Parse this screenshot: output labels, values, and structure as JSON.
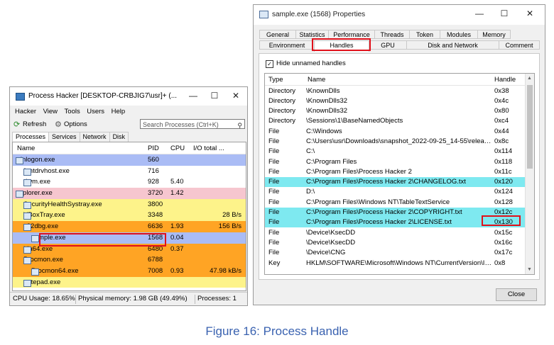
{
  "process_hacker": {
    "title": "Process Hacker [DESKTOP-CRBJIG7\\usr]+ (...",
    "menu": [
      "Hacker",
      "View",
      "Tools",
      "Users",
      "Help"
    ],
    "toolbar": {
      "refresh": "Refresh",
      "options": "Options",
      "search_placeholder": "Search Processes (Ctrl+K)"
    },
    "tabs": [
      "Processes",
      "Services",
      "Network",
      "Disk"
    ],
    "columns": {
      "name": "Name",
      "pid": "PID",
      "cpu": "CPU",
      "io": "I/O total ..."
    },
    "rows": [
      {
        "name": "winlogon.exe",
        "pid": "560",
        "cpu": "",
        "io": "",
        "color": "#aabcf5",
        "indent": 0,
        "expanded": true
      },
      {
        "name": "fontdrvhost.exe",
        "pid": "716",
        "cpu": "",
        "io": "",
        "color": "#ffffff",
        "indent": 1
      },
      {
        "name": "dwm.exe",
        "pid": "928",
        "cpu": "5.40",
        "io": "",
        "color": "#ffffff",
        "indent": 1
      },
      {
        "name": "explorer.exe",
        "pid": "3720",
        "cpu": "1.42",
        "io": "",
        "color": "#f6c6cf",
        "indent": 0,
        "expanded": true
      },
      {
        "name": "SecurityHealthSystray.exe",
        "pid": "3800",
        "cpu": "",
        "io": "",
        "color": "#fdf38a",
        "indent": 1
      },
      {
        "name": "VBoxTray.exe",
        "pid": "3348",
        "cpu": "",
        "io": "28 B/s",
        "color": "#fdf38a",
        "indent": 1
      },
      {
        "name": "x32dbg.exe",
        "pid": "6636",
        "cpu": "1.93",
        "io": "156 B/s",
        "color": "#ffa424",
        "indent": 1,
        "expanded": true
      },
      {
        "name": "sample.exe",
        "pid": "1568",
        "cpu": "0.04",
        "io": "",
        "color": "#aabcf5",
        "indent": 2
      },
      {
        "name": "ida64.exe",
        "pid": "6480",
        "cpu": "0.37",
        "io": "",
        "color": "#ffa424",
        "indent": 1
      },
      {
        "name": "Procmon.exe",
        "pid": "6788",
        "cpu": "",
        "io": "",
        "color": "#ffa424",
        "indent": 1,
        "expanded": true
      },
      {
        "name": "Procmon64.exe",
        "pid": "7008",
        "cpu": "0.93",
        "io": "47.98 kB/s",
        "color": "#ffa424",
        "indent": 2
      },
      {
        "name": "notepad.exe",
        "pid": "",
        "cpu": "",
        "io": "",
        "color": "#fdf38a",
        "indent": 1
      }
    ],
    "status": {
      "cpu": "CPU Usage: 18.65%",
      "memory": "Physical memory: 1.98 GB (49.49%)",
      "processes": "Processes: 1"
    }
  },
  "properties": {
    "title": "sample.exe (1568) Properties",
    "tabs_row1": [
      "General",
      "Statistics",
      "Performance",
      "Threads",
      "Token",
      "Modules",
      "Memory"
    ],
    "tabs_row2": [
      "Environment",
      "Handles",
      "GPU",
      "Disk and Network",
      "Comment"
    ],
    "active_tab": "Handles",
    "hide_unnamed": "Hide unnamed handles",
    "hide_unnamed_checked": true,
    "columns": {
      "type": "Type",
      "name": "Name",
      "handle": "Handle"
    },
    "rows": [
      {
        "type": "Directory",
        "name": "\\KnownDlls",
        "handle": "0x38",
        "highlight": false
      },
      {
        "type": "Directory",
        "name": "\\KnownDlls32",
        "handle": "0x4c",
        "highlight": false
      },
      {
        "type": "Directory",
        "name": "\\KnownDlls32",
        "handle": "0x80",
        "highlight": false
      },
      {
        "type": "Directory",
        "name": "\\Sessions\\1\\BaseNamedObjects",
        "handle": "0xc4",
        "highlight": false
      },
      {
        "type": "File",
        "name": "C:\\Windows",
        "handle": "0x44",
        "highlight": false
      },
      {
        "type": "File",
        "name": "C:\\Users\\usr\\Downloads\\snapshot_2022-09-25_14-55\\release...",
        "handle": "0x8c",
        "highlight": false
      },
      {
        "type": "File",
        "name": "C:\\",
        "handle": "0x114",
        "highlight": false
      },
      {
        "type": "File",
        "name": "C:\\Program Files",
        "handle": "0x118",
        "highlight": false
      },
      {
        "type": "File",
        "name": "C:\\Program Files\\Process Hacker 2",
        "handle": "0x11c",
        "highlight": false
      },
      {
        "type": "File",
        "name": "C:\\Program Files\\Process Hacker 2\\CHANGELOG.txt",
        "handle": "0x120",
        "highlight": true
      },
      {
        "type": "File",
        "name": "D:\\",
        "handle": "0x124",
        "highlight": false
      },
      {
        "type": "File",
        "name": "C:\\Program Files\\Windows NT\\TableTextService",
        "handle": "0x128",
        "highlight": false
      },
      {
        "type": "File",
        "name": "C:\\Program Files\\Process Hacker 2\\COPYRIGHT.txt",
        "handle": "0x12c",
        "highlight": true
      },
      {
        "type": "File",
        "name": "C:\\Program Files\\Process Hacker 2\\LICENSE.txt",
        "handle": "0x130",
        "highlight": true
      },
      {
        "type": "File",
        "name": "\\Device\\KsecDD",
        "handle": "0x15c",
        "highlight": false
      },
      {
        "type": "File",
        "name": "\\Device\\KsecDD",
        "handle": "0x16c",
        "highlight": false
      },
      {
        "type": "File",
        "name": "\\Device\\CNG",
        "handle": "0x17c",
        "highlight": false
      },
      {
        "type": "Key",
        "name": "HKLM\\SOFTWARE\\Microsoft\\Windows NT\\CurrentVersion\\Ima...",
        "handle": "0x8",
        "highlight": false
      }
    ],
    "close_label": "Close"
  },
  "caption": "Figure 16: Process Handle",
  "colors": {
    "highlight_cyan": "#7ee9f0",
    "annotation_red": "#e0101a",
    "caption_blue": "#3a62b0"
  }
}
